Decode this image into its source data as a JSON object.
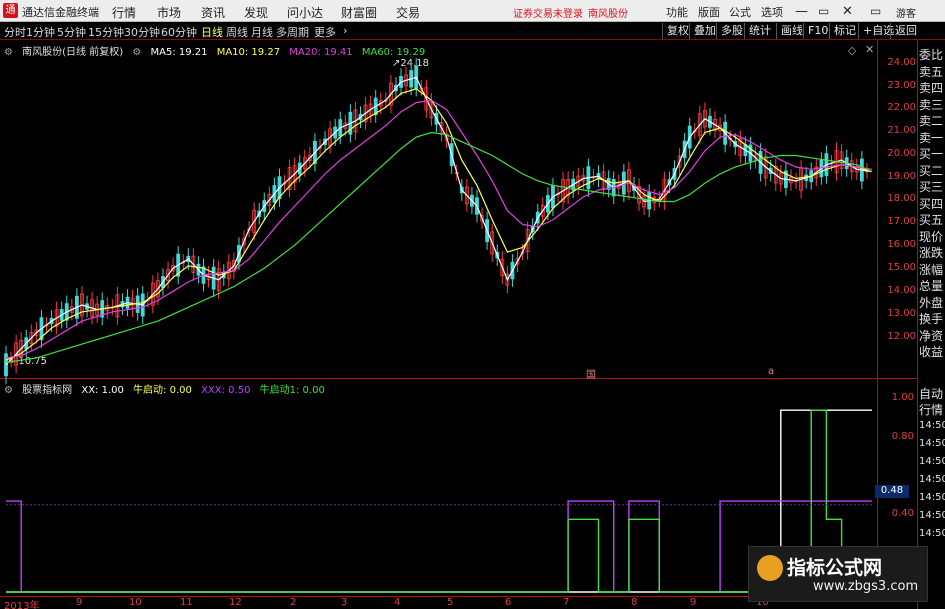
{
  "app": {
    "logo_glyph": "通",
    "title": "通达信金融终端",
    "menu": [
      "行情",
      "市场",
      "资讯",
      "发现",
      "问小达",
      "财富圈",
      "交易"
    ],
    "alert": "证券交易未登录",
    "stock_short": "南风股份",
    "right_menu": [
      "功能",
      "版面",
      "公式",
      "选项"
    ],
    "guest": "游客"
  },
  "toolbar": {
    "periods": [
      "分时",
      "1分钟",
      "5分钟",
      "15分钟",
      "30分钟",
      "60分钟",
      "日线",
      "周线",
      "月线",
      "多周期",
      "更多"
    ],
    "active_period": "日线",
    "right_buttons": [
      "复权",
      "叠加",
      "多股",
      "统计",
      "画线",
      "F10",
      "标记",
      "+自选",
      "返回"
    ]
  },
  "price_header": {
    "title": "南风股份(日线 前复权)",
    "ma5": "MA5: 19.21",
    "ma10": "MA10: 19.27",
    "ma20": "MA20: 19.41",
    "ma60": "MA60: 19.29",
    "colors": {
      "ma5": "#ffffff",
      "ma10": "#ffff55",
      "ma20": "#e040e0",
      "ma60": "#40e040"
    }
  },
  "indicator_header": {
    "title": "股票指标网",
    "xx": "XX: 1.00",
    "niu": "牛启动: 0.00",
    "xxx": "XXX: 0.50",
    "niu1": "牛启动1: 0.00",
    "colors": {
      "xx": "#ffffff",
      "niu": "#ffff55",
      "xxx": "#c040ff",
      "niu1": "#40e040"
    }
  },
  "price_axis_labels": [
    "24.00",
    "23.00",
    "22.00",
    "21.00",
    "20.00",
    "19.00",
    "18.00",
    "17.00",
    "16.00",
    "15.00",
    "14.00",
    "13.00",
    "12.00"
  ],
  "indicator_axis_labels": [
    "1.00",
    "0.80",
    "0.48",
    "0.40"
  ],
  "indicator_value_box": "0.48",
  "time_axis_labels": [
    "2013年",
    "9",
    "10",
    "11",
    "12",
    "2",
    "3",
    "4",
    "5",
    "6",
    "7",
    "8",
    "9",
    "10"
  ],
  "annotations": {
    "high": "24.18",
    "low": "10.75",
    "marker1": "国",
    "marker2": "a"
  },
  "side_panel": [
    "委比",
    "卖五",
    "卖四",
    "卖三",
    "卖二",
    "卖一",
    "买一",
    "买二",
    "买三",
    "买四",
    "买五",
    "现价",
    "涨跌",
    "涨幅",
    "总量",
    "外盘",
    "换手",
    "净资",
    "收益"
  ],
  "side_panel2": [
    "自动",
    "行情"
  ],
  "side_panel2_times": [
    "14:50",
    "14:50",
    "14:50",
    "14:50",
    "14:50",
    "14:50",
    "14:50"
  ],
  "watermark": {
    "line1": "指标公式网",
    "line2": "www.zbgs3.com"
  },
  "chart_data": [
    {
      "type": "line",
      "ylim": [
        10.5,
        24.5
      ],
      "series": [
        {
          "name": "MA5",
          "color": "#ffffff",
          "values": [
            10.9,
            11.6,
            12.3,
            12.8,
            13.2,
            13.5,
            13.3,
            13.4,
            13.6,
            13.5,
            14.2,
            15.1,
            15.5,
            14.8,
            14.6,
            15.2,
            16.8,
            17.8,
            18.6,
            19.2,
            19.9,
            20.6,
            21.2,
            21.5,
            22.0,
            22.4,
            23.2,
            23.4,
            22.0,
            20.8,
            18.5,
            17.8,
            16.2,
            14.6,
            15.8,
            17.3,
            18.2,
            18.6,
            19.0,
            19.1,
            18.6,
            18.9,
            18.0,
            18.1,
            19.2,
            20.8,
            21.6,
            21.2,
            20.5,
            20.1,
            19.5,
            19.0,
            18.9,
            19.1,
            19.6,
            19.8,
            19.4,
            19.3
          ]
        },
        {
          "name": "MA10",
          "color": "#ffff55",
          "values": [
            11.1,
            11.4,
            11.9,
            12.5,
            12.9,
            13.2,
            13.3,
            13.4,
            13.5,
            13.6,
            14.0,
            14.7,
            15.2,
            15.1,
            14.8,
            15.0,
            16.1,
            17.2,
            18.2,
            18.9,
            19.5,
            20.2,
            20.8,
            21.3,
            21.7,
            22.1,
            22.7,
            22.9,
            22.4,
            21.4,
            19.8,
            18.7,
            17.2,
            15.8,
            16.0,
            16.8,
            17.7,
            18.3,
            18.7,
            19.0,
            18.8,
            18.9,
            18.3,
            18.0,
            18.7,
            19.9,
            21.0,
            21.2,
            20.8,
            20.3,
            19.8,
            19.3,
            19.0,
            19.1,
            19.4,
            19.6,
            19.5,
            19.3
          ]
        },
        {
          "name": "MA20",
          "color": "#e040e0",
          "values": [
            11.2,
            11.3,
            11.6,
            12.0,
            12.4,
            12.8,
            13.0,
            13.2,
            13.3,
            13.4,
            13.7,
            14.1,
            14.5,
            14.8,
            14.9,
            15.0,
            15.5,
            16.3,
            17.1,
            17.8,
            18.5,
            19.2,
            19.8,
            20.3,
            20.8,
            21.3,
            21.9,
            22.3,
            22.4,
            22.0,
            21.0,
            20.0,
            18.9,
            17.6,
            17.0,
            16.9,
            17.2,
            17.7,
            18.2,
            18.5,
            18.6,
            18.8,
            18.5,
            18.3,
            18.6,
            19.3,
            20.2,
            20.8,
            20.9,
            20.6,
            20.2,
            19.8,
            19.5,
            19.4,
            19.5,
            19.6,
            19.5,
            19.4
          ]
        },
        {
          "name": "MA60",
          "color": "#40e040",
          "values": [
            11.0,
            11.1,
            11.2,
            11.4,
            11.6,
            11.8,
            12.0,
            12.2,
            12.4,
            12.6,
            12.8,
            13.1,
            13.4,
            13.7,
            14.0,
            14.3,
            14.7,
            15.1,
            15.6,
            16.1,
            16.7,
            17.3,
            17.9,
            18.5,
            19.1,
            19.7,
            20.3,
            20.8,
            21.0,
            20.9,
            20.6,
            20.3,
            20.0,
            19.6,
            19.2,
            18.9,
            18.7,
            18.6,
            18.5,
            18.4,
            18.3,
            18.2,
            18.1,
            18.0,
            18.0,
            18.3,
            18.8,
            19.2,
            19.5,
            19.7,
            19.9,
            20.0,
            20.0,
            19.9,
            19.8,
            19.7,
            19.6,
            19.3
          ]
        }
      ]
    },
    {
      "type": "line",
      "ylim": [
        0,
        1.1
      ],
      "series": [
        {
          "name": "XX",
          "color": "#ffffff",
          "values": [
            0,
            0,
            0,
            0,
            0,
            0,
            0,
            0,
            0,
            0,
            0,
            0,
            0,
            0,
            0,
            0,
            0,
            0,
            0,
            0,
            0,
            0,
            0,
            0,
            0,
            0,
            0,
            0,
            0,
            0,
            0,
            0,
            0,
            0,
            0,
            0,
            0,
            0,
            0,
            0,
            0,
            0,
            0,
            0,
            0,
            0,
            0,
            0,
            0,
            0,
            0,
            1,
            1,
            1,
            1,
            1,
            1,
            1
          ]
        },
        {
          "name": "XXX",
          "color": "#c040ff",
          "values": [
            0.5,
            0,
            0,
            0,
            0,
            0,
            0,
            0,
            0,
            0,
            0,
            0,
            0,
            0,
            0,
            0,
            0,
            0,
            0,
            0,
            0,
            0,
            0,
            0,
            0,
            0,
            0,
            0,
            0,
            0,
            0,
            0,
            0,
            0,
            0,
            0,
            0,
            0.5,
            0.5,
            0.5,
            0,
            0.5,
            0.5,
            0,
            0,
            0,
            0,
            0.5,
            0.5,
            0.5,
            0.5,
            0.5,
            0.5,
            0.5,
            0.5,
            0.5,
            0.5,
            0.5
          ]
        },
        {
          "name": "牛启动1",
          "color": "#40e040",
          "values": [
            0,
            0,
            0,
            0,
            0,
            0,
            0,
            0,
            0,
            0,
            0,
            0,
            0,
            0,
            0,
            0,
            0,
            0,
            0,
            0,
            0,
            0,
            0,
            0,
            0,
            0,
            0,
            0,
            0,
            0,
            0,
            0,
            0,
            0,
            0,
            0,
            0,
            0.4,
            0.4,
            0,
            0,
            0.4,
            0.4,
            0,
            0,
            0,
            0,
            0,
            0,
            0,
            0,
            0,
            0,
            1,
            0.4,
            0,
            0,
            0
          ]
        }
      ]
    }
  ]
}
